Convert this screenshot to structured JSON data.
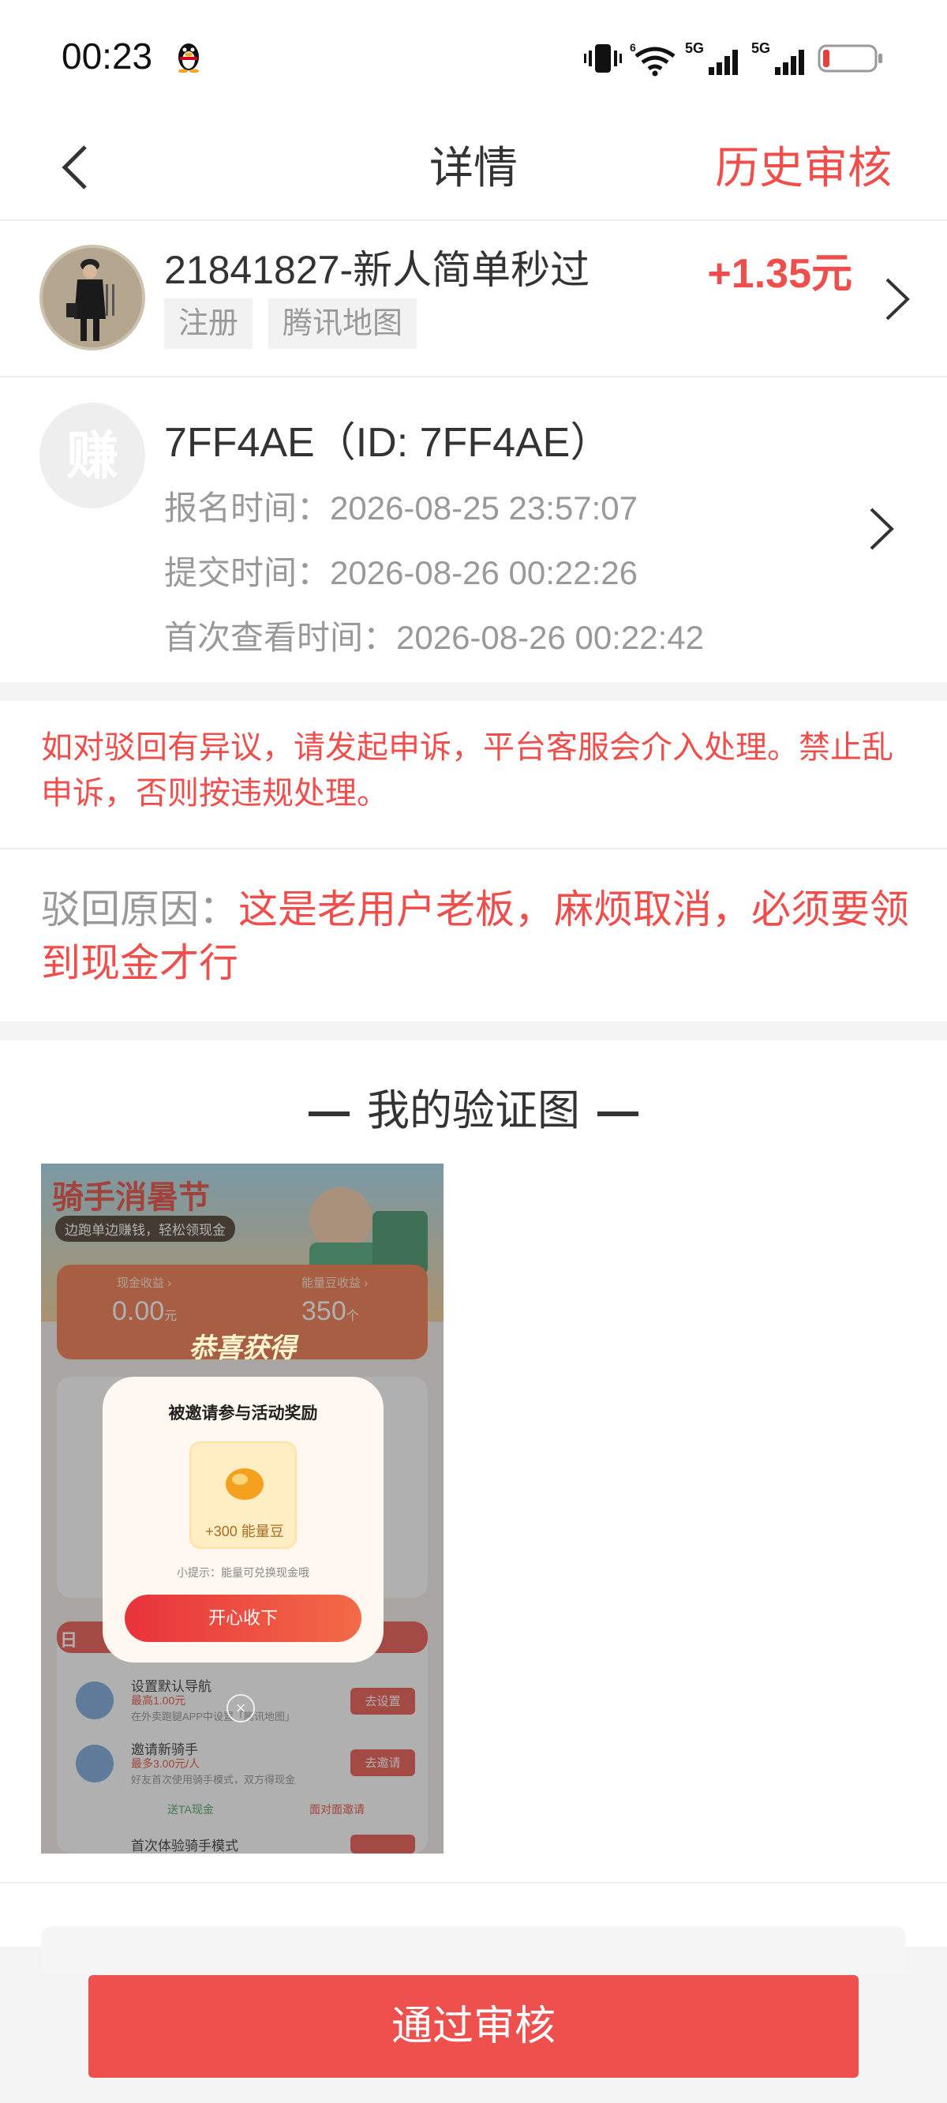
{
  "status_bar": {
    "time": "00:23",
    "network1": "5G",
    "network2": "5G",
    "wifi_sup": "6"
  },
  "nav": {
    "title": "详情",
    "history": "历史审核"
  },
  "task": {
    "title": "21841827-新人简单秒过",
    "reward": "+1.35元",
    "tags": [
      "注册",
      "腾讯地图"
    ]
  },
  "user": {
    "avatar_char": "赚",
    "id_line": "7FF4AE（ID: 7FF4AE）",
    "signup_time": "报名时间：2026-08-25 23:57:07",
    "submit_time": "提交时间：2026-08-26 00:22:26",
    "first_view_time": "首次查看时间：2026-08-26 00:22:42"
  },
  "notice": "如对驳回有异议，请发起申诉，平台客服会介入处理。禁止乱申诉，否则按违规处理。",
  "reject": {
    "label": "驳回原因：",
    "text": "这是老用户老板，麻烦取消，必须要领到现金才行"
  },
  "proof": {
    "title": "我的验证图",
    "banner_title": "骑手消暑节",
    "banner_sub": "边跑单边赚钱，轻松领现金",
    "cash_label": "现金收益 ›",
    "cash_value": "0.00",
    "cash_unit": "元",
    "bean_label": "能量豆收益 ›",
    "bean_value": "350",
    "bean_unit": "个",
    "congrats": "恭喜获得",
    "popup_title": "被邀请参与活动奖励",
    "popup_reward": "+300 能量豆",
    "popup_tip": "小提示：能量可兑换现金哦",
    "popup_button": "开心收下",
    "daily_title": "日",
    "tasks": [
      {
        "name": "设置默认导航",
        "reward": "最高1.00元",
        "desc": "在外卖跑腿APP中设置「腾讯地图」",
        "btn": "去设置"
      },
      {
        "name": "邀请新骑手",
        "reward": "最多3.00元/人",
        "desc": "好友首次使用骑手模式，双方得现金",
        "btn": "去邀请"
      },
      {
        "name": "首次体验骑手模式",
        "reward": "",
        "desc": "",
        "btn": ""
      }
    ],
    "send_cash": "送TA现金",
    "face_invite": "面对面邀请"
  },
  "bottom": {
    "approve": "通过审核"
  },
  "colors": {
    "accent": "#ee4f4c",
    "muted": "#999999",
    "text": "#333333"
  }
}
